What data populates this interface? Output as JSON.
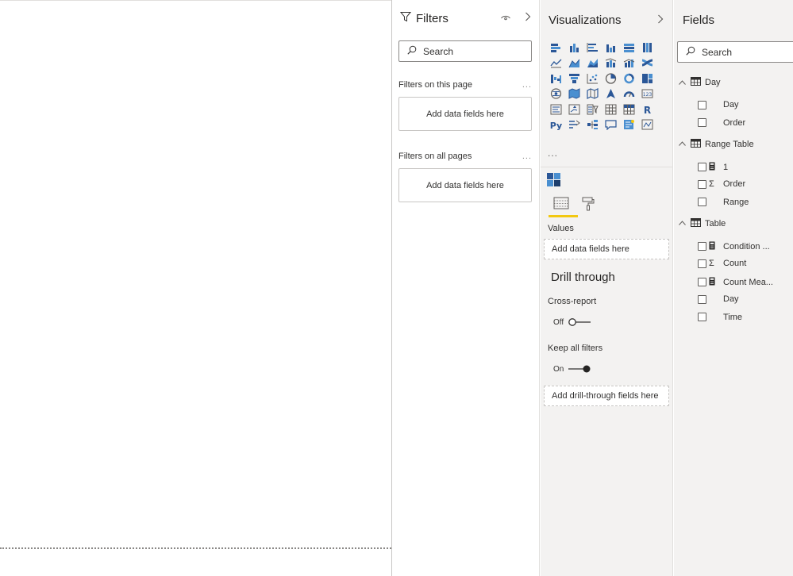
{
  "filters": {
    "title": "Filters",
    "search_placeholder": "Search",
    "sections": [
      {
        "label": "Filters on this page",
        "drop_label": "Add data fields here"
      },
      {
        "label": "Filters on all pages",
        "drop_label": "Add data fields here"
      }
    ],
    "more": "..."
  },
  "visualizations": {
    "title": "Visualizations",
    "more": "...",
    "icons": [
      "stacked-bar-icon",
      "stacked-column-icon",
      "clustered-bar-icon",
      "clustered-column-icon",
      "100-stacked-bar-icon",
      "100-stacked-column-icon",
      "line-chart-icon",
      "area-chart-icon",
      "stacked-area-icon",
      "line-clustered-column-icon",
      "line-stacked-column-icon",
      "ribbon-chart-icon",
      "waterfall-icon",
      "funnel-icon",
      "scatter-icon",
      "pie-chart-icon",
      "donut-chart-icon",
      "treemap-icon",
      "map-icon",
      "filled-map-icon",
      "shape-map-icon",
      "azure-map-icon",
      "gauge-icon",
      "card-icon",
      "multi-row-card-icon",
      "kpi-icon",
      "slicer-icon",
      "table-icon",
      "matrix-icon",
      "r-visual-icon",
      "python-visual-icon",
      "key-influencers-icon",
      "decomposition-tree-icon",
      "qa-icon",
      "smart-narrative-icon",
      "paginated-report-icon"
    ],
    "values_label": "Values",
    "values_drop": "Add data fields here",
    "drill_title": "Drill through",
    "cross_report_label": "Cross-report",
    "cross_report_state": "Off",
    "keep_filters_label": "Keep all filters",
    "keep_filters_state": "On",
    "drill_drop": "Add drill-through fields here"
  },
  "fields": {
    "title": "Fields",
    "search_placeholder": "Search",
    "tables": [
      {
        "name": "Day",
        "fields": [
          {
            "label": "Day",
            "type": ""
          },
          {
            "label": "Order",
            "type": ""
          }
        ]
      },
      {
        "name": "Range Table",
        "fields": [
          {
            "label": "1",
            "type": "measure"
          },
          {
            "label": "Order",
            "type": "sum"
          },
          {
            "label": "Range",
            "type": ""
          }
        ]
      },
      {
        "name": "Table",
        "fields": [
          {
            "label": "Condition ...",
            "type": "measure"
          },
          {
            "label": "Count",
            "type": "sum"
          },
          {
            "label": "Count Mea...",
            "type": "measure"
          },
          {
            "label": "Day",
            "type": ""
          },
          {
            "label": "Time",
            "type": ""
          }
        ]
      }
    ]
  }
}
